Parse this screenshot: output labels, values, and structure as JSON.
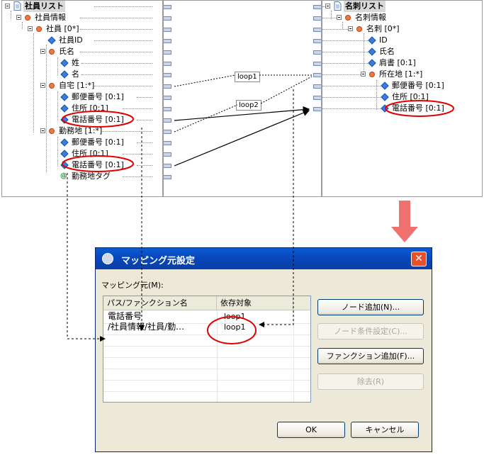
{
  "left_tree": {
    "root": "社員リスト",
    "nodes": [
      {
        "label": "社員情報"
      },
      {
        "label": "社員 [0*]"
      },
      {
        "label": "社員ID"
      },
      {
        "label": "氏名"
      },
      {
        "label": "姓"
      },
      {
        "label": "名"
      },
      {
        "label": "自宅 [1:*]"
      },
      {
        "label": "郵便番号 [0:1]"
      },
      {
        "label": "住所 [0:1]"
      },
      {
        "label": "電話番号 [0:1]"
      },
      {
        "label": "勤務地 [1:*]"
      },
      {
        "label": "郵便番号 [0:1]"
      },
      {
        "label": "住所 [0:1]"
      },
      {
        "label": "電話番号 [0:1]"
      },
      {
        "label": "勤務地タグ"
      }
    ]
  },
  "right_tree": {
    "root": "名刺リスト",
    "nodes": [
      {
        "label": "名刺情報"
      },
      {
        "label": "名刺 [0*]"
      },
      {
        "label": "ID"
      },
      {
        "label": "氏名"
      },
      {
        "label": "肩書 [0:1]"
      },
      {
        "label": "所在地 [1:*]"
      },
      {
        "label": "郵便番号 [0:1]"
      },
      {
        "label": "住所 [0:1]"
      },
      {
        "label": "電話番号 [0:1]"
      }
    ]
  },
  "loops": {
    "loop1": "loop1",
    "loop2": "loop2"
  },
  "dialog": {
    "title": "マッピング元設定",
    "close": "✕",
    "source_label": "マッピング元(M):",
    "columns": [
      "パス/ファンクション名",
      "依存対象"
    ],
    "rows": [
      {
        "path_line1": "電話番号",
        "path_line2": "/社員情報/社員/勤…",
        "dep": "loop1",
        "dep2": "loop1"
      }
    ],
    "buttons": {
      "add_node": "ノード追加(N)...",
      "node_condition": "ノード条件設定(C)...",
      "add_function": "ファンクション追加(F)...",
      "remove": "除去(R)",
      "ok": "OK",
      "cancel": "キャンセル"
    }
  },
  "colors": {
    "title_bar": "#0846b8",
    "highlight": "#e00000",
    "arrow": "#f07070"
  }
}
